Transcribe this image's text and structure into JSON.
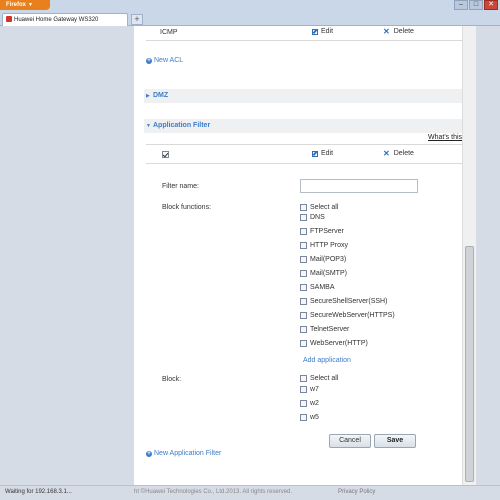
{
  "browser": {
    "app_button": "Firefox",
    "tab_title": "Huawei Home Gateway WS320",
    "new_tab": "+",
    "window_controls": [
      "–",
      "□",
      "✕"
    ],
    "status": "Waiting for 192.168.3.1..."
  },
  "acl": {
    "row_label": "ICMP",
    "edit_label": "Edit",
    "delete_label": "Delete",
    "new_acl": "New ACL"
  },
  "dmz": {
    "title": "DMZ"
  },
  "app_filter": {
    "title": "Application Filter",
    "whats_this": "What's this?",
    "header_edit": "Edit",
    "header_delete": "Delete",
    "filter_name_label": "Filter name:",
    "filter_name_value": "",
    "block_functions_label": "Block functions:",
    "functions": [
      "Select all",
      "DNS",
      "FTPServer",
      "HTTP Proxy",
      "Mail(POP3)",
      "Mail(SMTP)",
      "SAMBA",
      "SecureShellServer(SSH)",
      "SecureWebServer(HTTPS)",
      "TelnetServer",
      "WebServer(HTTP)"
    ],
    "add_application": "Add application",
    "block_label": "Block:",
    "block_options": [
      "Select all",
      "w7",
      "w2",
      "w5"
    ],
    "cancel": "Cancel",
    "save": "Save",
    "new_filter": "New Application Filter"
  },
  "footer": {
    "copyright": "ht ©Huawei Technologies Co., Ltd.2013. All rights reserved.",
    "privacy": "Privacy Policy"
  },
  "colors": {
    "accent": "#3d7cc9",
    "firefox": "#e8801e"
  }
}
